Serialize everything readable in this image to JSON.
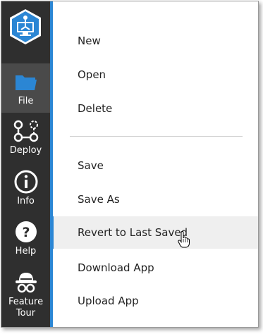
{
  "sidebar": {
    "items": [
      {
        "label": "File",
        "icon": "folder-icon",
        "active": true
      },
      {
        "label": "Deploy",
        "icon": "deploy-nodes-icon"
      },
      {
        "label": "Info",
        "icon": "info-icon"
      },
      {
        "label": "Help",
        "icon": "help-icon"
      },
      {
        "label_line1": "Feature",
        "label_line2": "Tour",
        "icon": "explorer-hat-icon"
      }
    ]
  },
  "menu": {
    "group1": [
      {
        "label": "New"
      },
      {
        "label": "Open"
      },
      {
        "label": "Delete"
      }
    ],
    "group2": [
      {
        "label": "Save"
      },
      {
        "label": "Save As"
      },
      {
        "label": "Revert to Last Saved",
        "hovered": true
      },
      {
        "label": "Download App"
      },
      {
        "label": "Upload App"
      }
    ]
  },
  "colors": {
    "sidebar_bg": "#2f2f2f",
    "sidebar_active_bg": "#4a4a4a",
    "accent": "#2b86d4",
    "folder_icon": "#2b86d4"
  }
}
